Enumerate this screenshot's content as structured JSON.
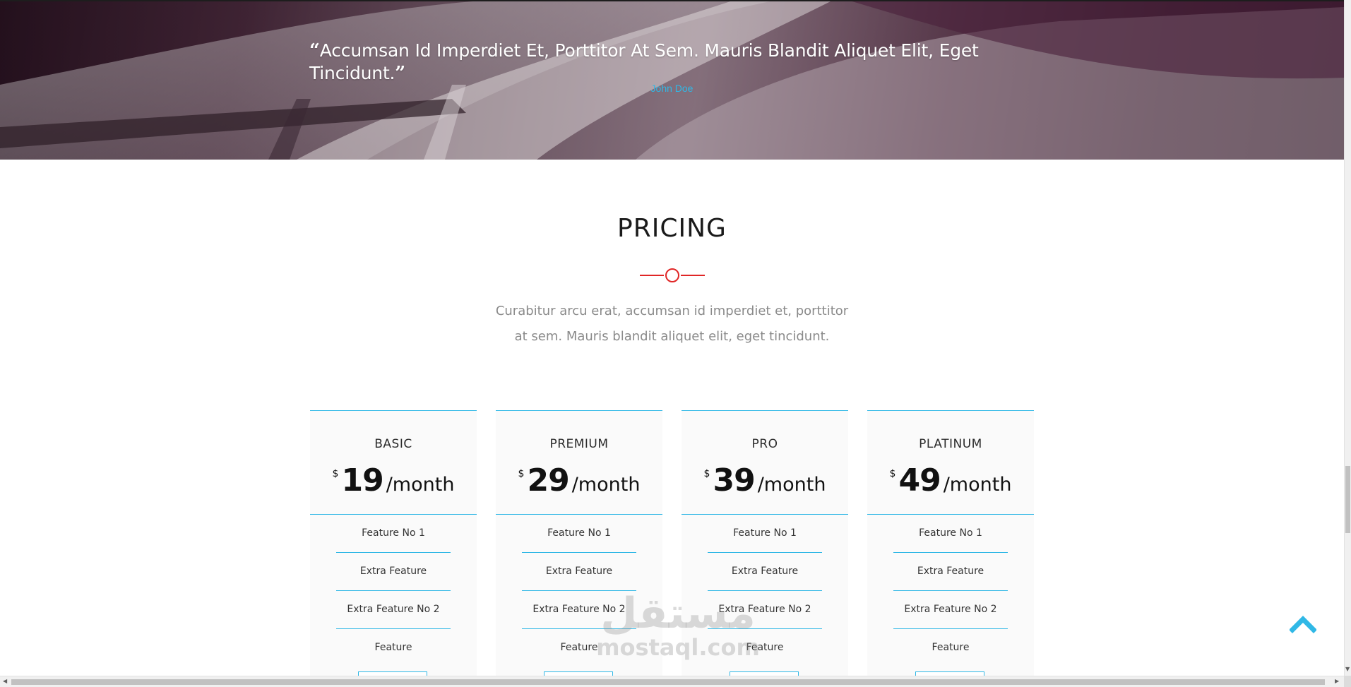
{
  "testimonial": {
    "open_quote": "“",
    "text": "Accumsan Id Imperdiet Et, Porttitor At Sem. Mauris Blandit Aliquet Elit, Eget Tincidunt.",
    "close_quote": "”",
    "author": "John Doe"
  },
  "pricing": {
    "title": "PRICING",
    "description": "Curabitur arcu erat, accumsan id imperdiet et, porttitor at sem. Mauris blandit aliquet elit, eget tincidunt.",
    "currency": "$",
    "period": "/month",
    "plans": [
      {
        "name": "BASIC",
        "amount": "19",
        "features": [
          "Feature No 1",
          "Extra Feature",
          "Extra Feature No 2",
          "Feature"
        ]
      },
      {
        "name": "PREMIUM",
        "amount": "29",
        "features": [
          "Feature No 1",
          "Extra Feature",
          "Extra Feature No 2",
          "Feature"
        ]
      },
      {
        "name": "PRO",
        "amount": "39",
        "features": [
          "Feature No 1",
          "Extra Feature",
          "Extra Feature No 2",
          "Feature"
        ]
      },
      {
        "name": "PLATINUM",
        "amount": "49",
        "features": [
          "Feature No 1",
          "Extra Feature",
          "Extra Feature No 2",
          "Feature"
        ]
      }
    ]
  },
  "watermark": {
    "arabic": "مستقل",
    "latin": "mostaql.com"
  },
  "icons": {
    "back_to_top": "chevron-up-icon",
    "divider": "circle-divider-icon",
    "scroll_left": "arrow-left-icon",
    "scroll_right": "arrow-right-icon",
    "scroll_down": "arrow-down-icon"
  },
  "colors": {
    "accent": "#30b8e6",
    "divider_red": "#e02626",
    "title": "#1a1a1a",
    "muted_text": "#8a8a8a",
    "card_bg": "#fafafa"
  }
}
